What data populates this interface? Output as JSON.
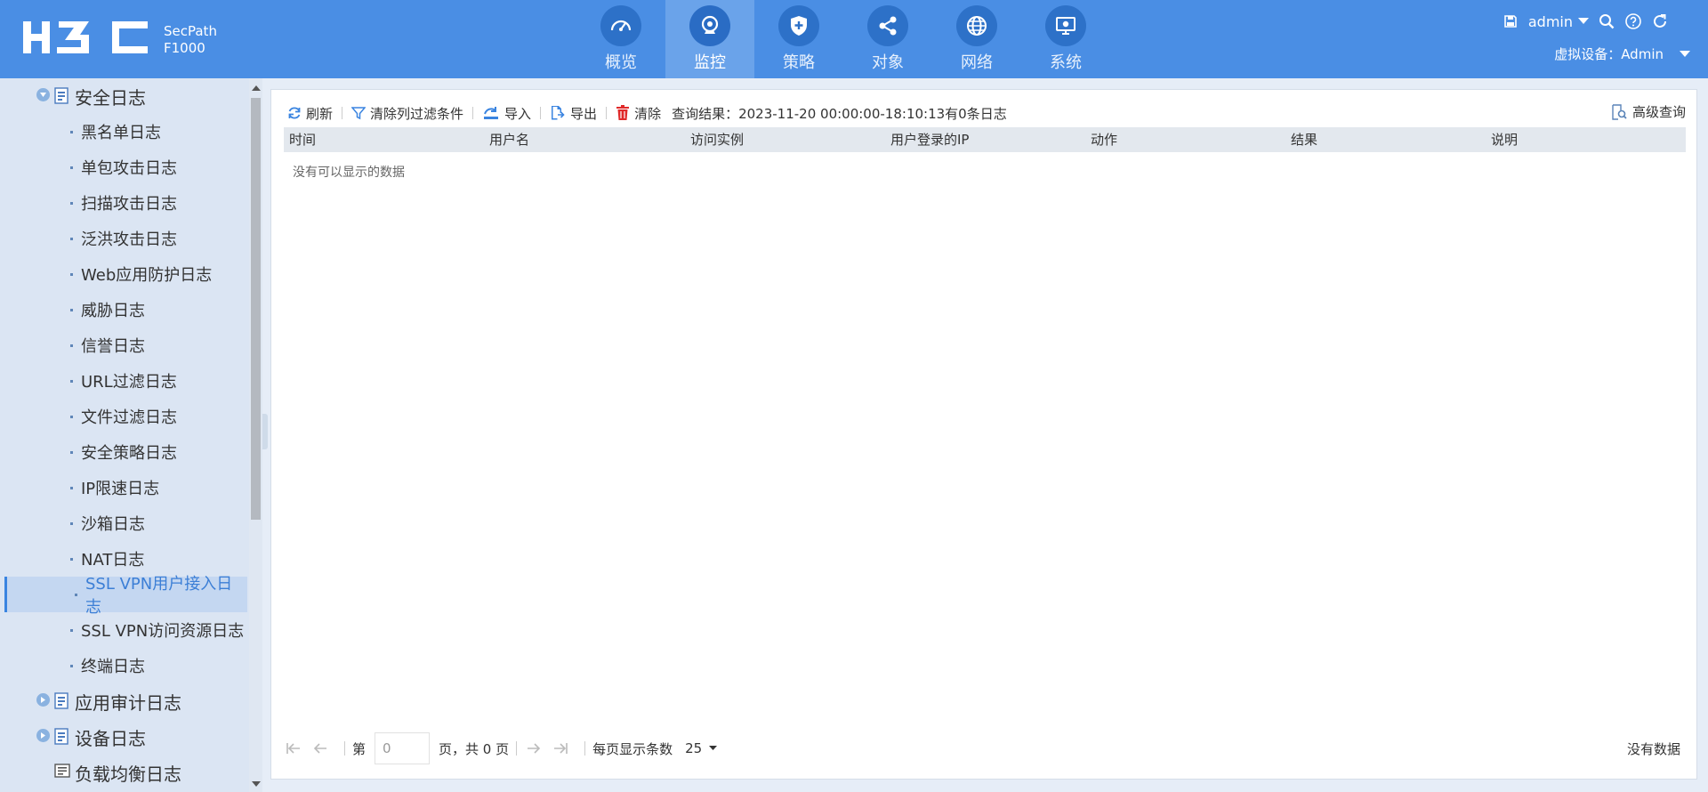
{
  "brand": {
    "product_line1": "SecPath",
    "product_line2": "F1000"
  },
  "nav": [
    {
      "label": "概览",
      "icon": "dashboard-icon"
    },
    {
      "label": "监控",
      "icon": "camera-icon",
      "active": true
    },
    {
      "label": "策略",
      "icon": "shield-plus-icon"
    },
    {
      "label": "对象",
      "icon": "share-nodes-icon"
    },
    {
      "label": "网络",
      "icon": "globe-icon"
    },
    {
      "label": "系统",
      "icon": "monitor-gear-icon"
    }
  ],
  "header": {
    "user": "admin",
    "virtual_device": "虚拟设备：Admin"
  },
  "sidebar": {
    "groups": [
      {
        "label": "安全日志"
      },
      {
        "label": "应用审计日志"
      },
      {
        "label": "设备日志"
      },
      {
        "label": "负载均衡日志"
      }
    ],
    "children": [
      "黑名单日志",
      "单包攻击日志",
      "扫描攻击日志",
      "泛洪攻击日志",
      "Web应用防护日志",
      "威胁日志",
      "信誉日志",
      "URL过滤日志",
      "文件过滤日志",
      "安全策略日志",
      "IP限速日志",
      "沙箱日志",
      "NAT日志",
      "SSL VPN用户接入日志",
      "SSL VPN访问资源日志",
      "终端日志"
    ],
    "selected": "SSL VPN用户接入日志"
  },
  "toolbar": {
    "refresh": "刷新",
    "clear_filters": "清除列过滤条件",
    "import": "导入",
    "export": "导出",
    "clear": "清除",
    "query_result": "查询结果：2023-11-20 00:00:00-18:10:13有0条日志",
    "advanced_query": "高级查询"
  },
  "table": {
    "columns": [
      "时间",
      "用户名",
      "访问实例",
      "用户登录的IP",
      "动作",
      "结果",
      "说明"
    ],
    "empty_message": "没有可以显示的数据"
  },
  "pager": {
    "page_prefix": "第",
    "page_value": "0",
    "page_suffix": "页，共 0 页",
    "per_page_label": "每页显示条数",
    "per_page_value": "25",
    "status": "没有数据"
  },
  "colors": {
    "header_bg": "#4a8ee4",
    "nav_active": "#6aa3ea",
    "sidebar_bg": "#dbe5f3",
    "selected_text": "#3c7fd6"
  }
}
